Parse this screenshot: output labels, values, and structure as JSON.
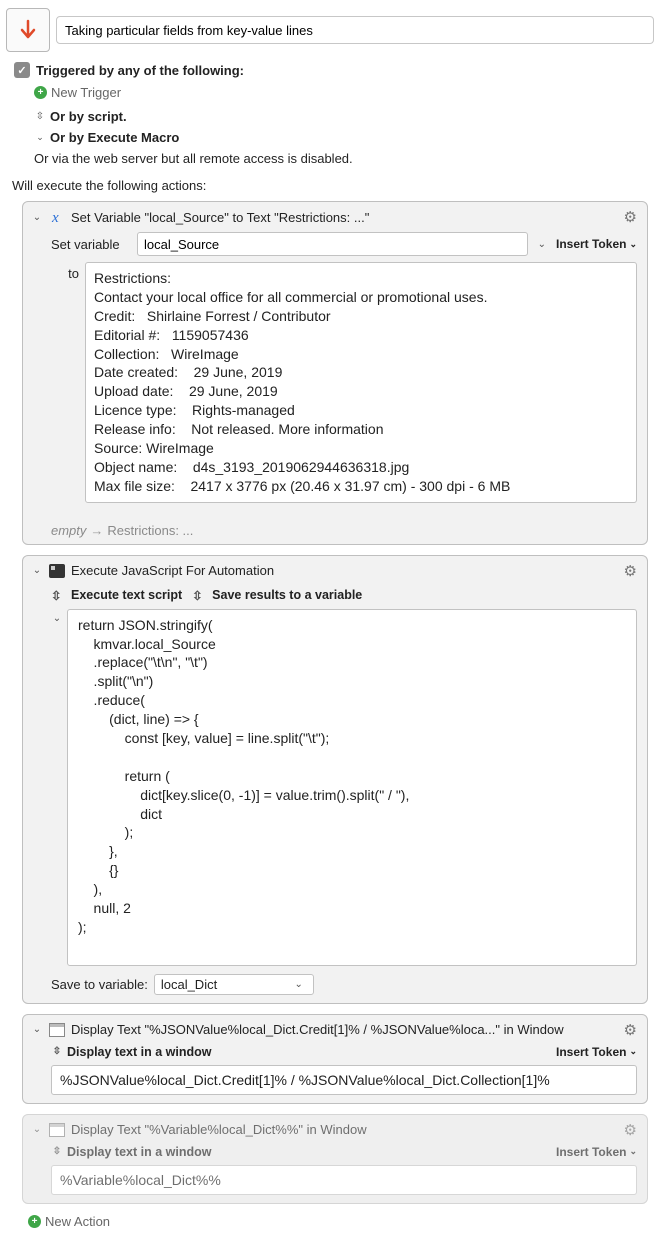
{
  "title": "Taking particular fields from key-value lines",
  "triggers": {
    "checkbox_label": "Triggered by any of the following:",
    "new_trigger": "New Trigger",
    "by_script": "Or by script.",
    "by_macro": "Or by Execute Macro",
    "web_disabled": "Or via the web server but all remote access is disabled."
  },
  "exec_label": "Will execute the following actions:",
  "action1": {
    "title": "Set Variable \"local_Source\" to Text \"Restrictions:   ...\"",
    "set_variable_label": "Set variable",
    "variable_name": "local_Source",
    "insert_token": "Insert Token",
    "to_label": "to",
    "text_value": "Restrictions:\nContact your local office for all commercial or promotional uses.\nCredit:   Shirlaine Forrest / Contributor\nEditorial #:   1159057436\nCollection:   WireImage\nDate created:    29 June, 2019\nUpload date:    29 June, 2019\nLicence type:    Rights-managed\nRelease info:    Not released. More information\nSource: WireImage\nObject name:    d4s_3193_2019062944636318.jpg\nMax file size:    2417 x 3776 px (20.46 x 31.97 cm) - 300 dpi - 6 MB",
    "footer_empty": "empty",
    "footer_hint": "Restrictions:   ..."
  },
  "action2": {
    "title": "Execute JavaScript For Automation",
    "opt_execute": "Execute text script",
    "opt_save": "Save results to a variable",
    "code": "return JSON.stringify(\n    kmvar.local_Source\n    .replace(\"\\t\\n\", \"\\t\")\n    .split(\"\\n\")\n    .reduce(\n        (dict, line) => {\n            const [key, value] = line.split(\"\\t\");\n\n            return (\n                dict[key.slice(0, -1)] = value.trim().split(\" / \"),\n                dict\n            );\n        },\n        {}\n    ),\n    null, 2\n);",
    "save_label": "Save to variable:",
    "save_var": "local_Dict"
  },
  "action3": {
    "title": "Display Text \"%JSONValue%local_Dict.Credit[1]% / %JSONValue%loca...\" in Window",
    "subhead": "Display text in a window",
    "insert_token": "Insert Token",
    "value": "%JSONValue%local_Dict.Credit[1]% / %JSONValue%local_Dict.Collection[1]%"
  },
  "action4": {
    "title": "Display Text \"%Variable%local_Dict%%\" in Window",
    "subhead": "Display text in a window",
    "insert_token": "Insert Token",
    "value": "%Variable%local_Dict%%"
  },
  "new_action": "New Action"
}
